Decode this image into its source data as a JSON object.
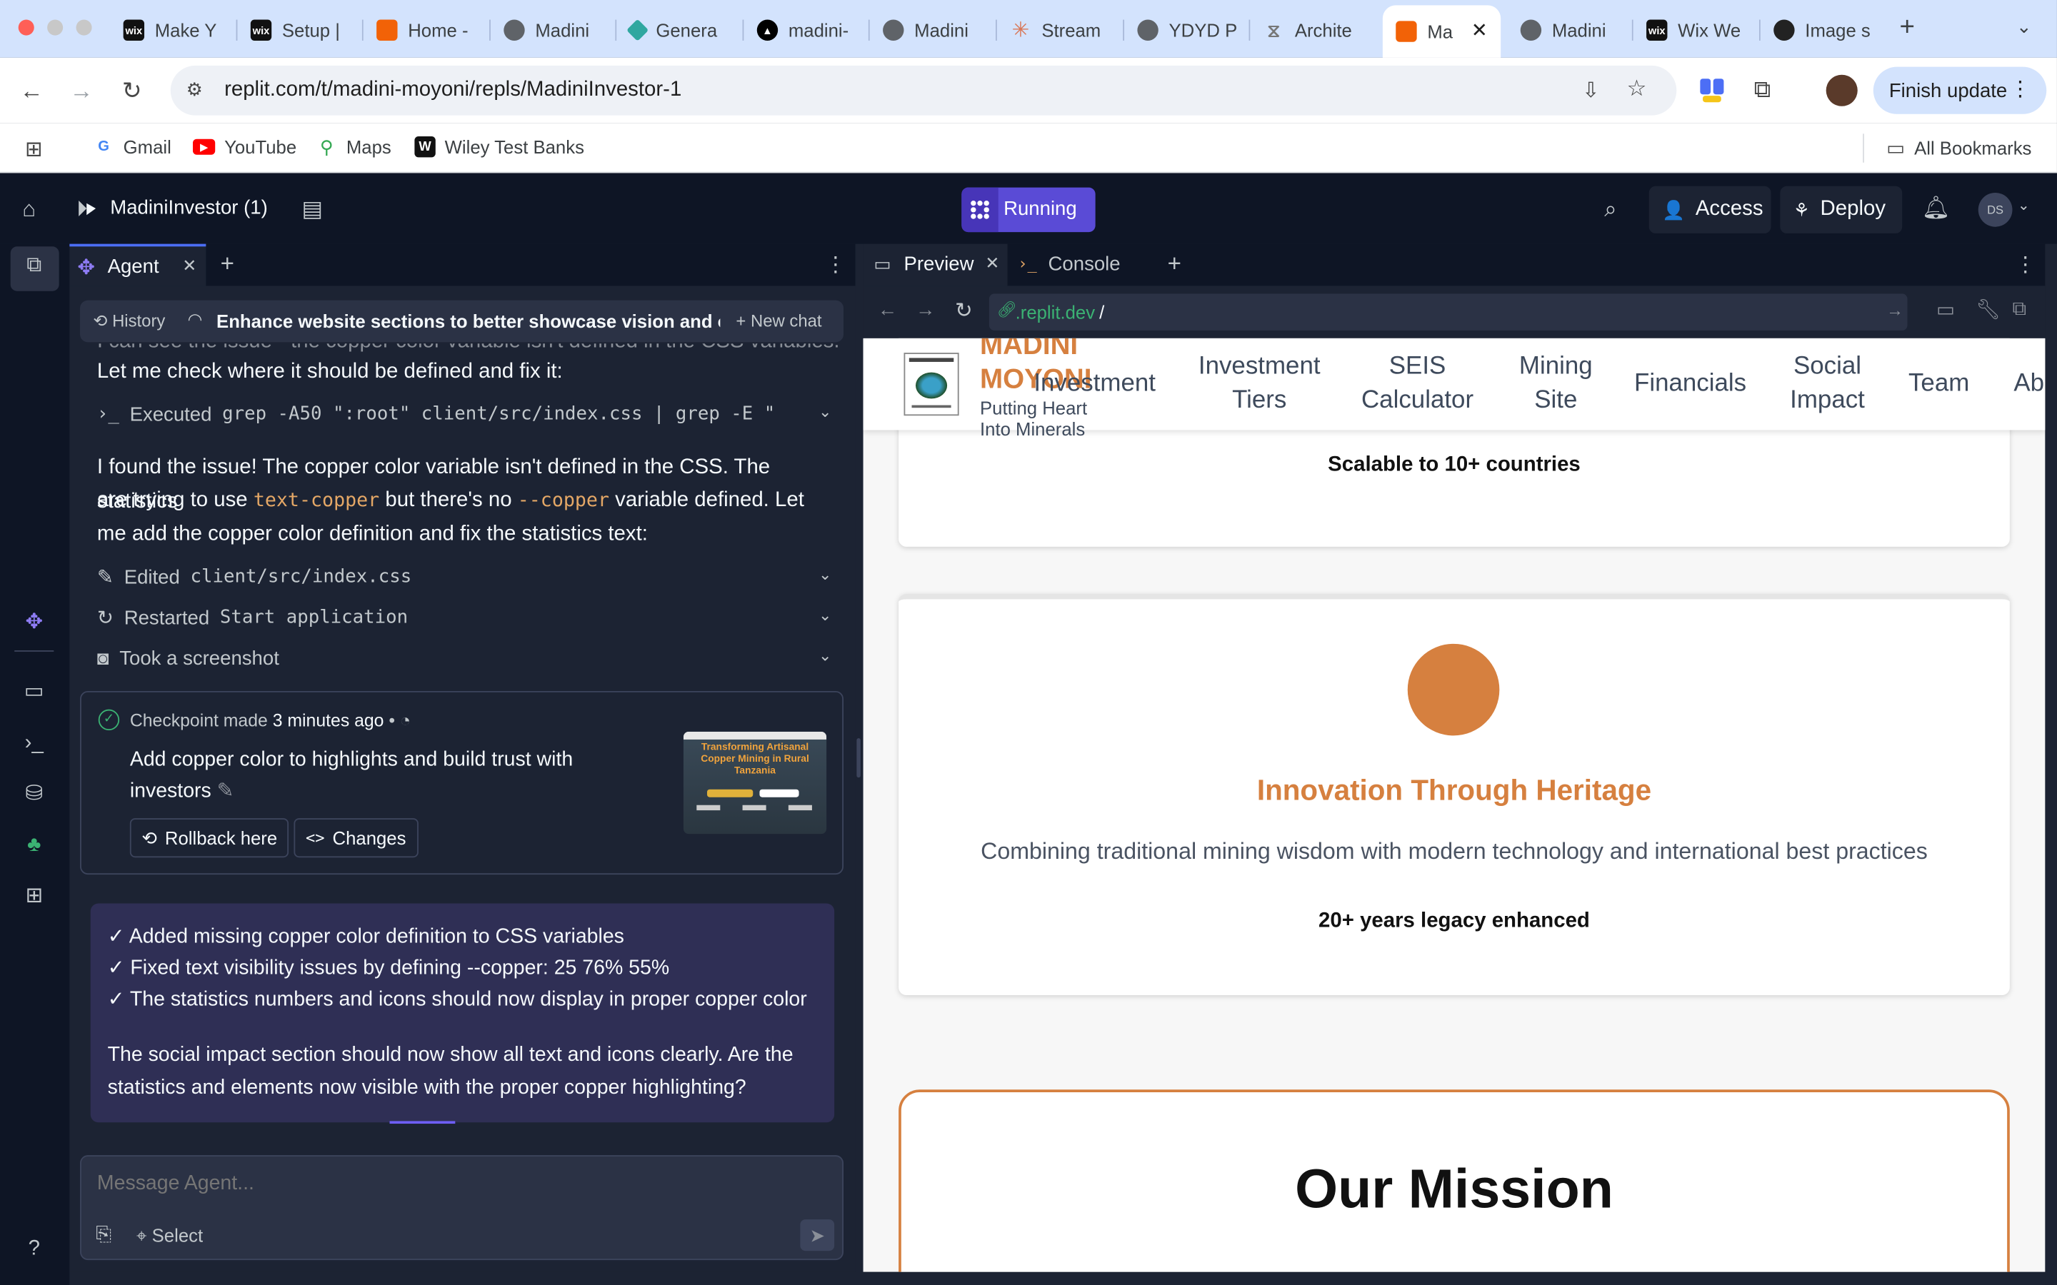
{
  "browser": {
    "tabs": [
      {
        "label": "Make Y",
        "icon": "wix"
      },
      {
        "label": "Setup |",
        "icon": "wix"
      },
      {
        "label": "Home -",
        "icon": "replit"
      },
      {
        "label": "Madini",
        "icon": "globe"
      },
      {
        "label": "Genera",
        "icon": "diamond"
      },
      {
        "label": "madini-",
        "icon": "triangle"
      },
      {
        "label": "Madini",
        "icon": "globe"
      },
      {
        "label": "Stream",
        "icon": "claude"
      },
      {
        "label": "YDYD P",
        "icon": "globe"
      },
      {
        "label": "Archite",
        "icon": "architect"
      },
      {
        "label": "Ma",
        "icon": "replit",
        "active": true
      },
      {
        "label": "Madini",
        "icon": "globe"
      },
      {
        "label": "Wix We",
        "icon": "wix"
      },
      {
        "label": "Image s",
        "icon": "openai"
      }
    ],
    "url": "replit.com/t/madini-moyoni/repls/MadiniInvestor-1",
    "finish_update": "Finish update",
    "bookmarks": [
      "Gmail",
      "YouTube",
      "Maps",
      "Wiley Test Banks"
    ],
    "all_bookmarks": "All Bookmarks"
  },
  "replit": {
    "project_name": "MadiniInvestor (1)",
    "status": "Running",
    "access": "Access",
    "deploy": "Deploy",
    "avatar": "DS"
  },
  "agent": {
    "tab_label": "Agent",
    "history": "History",
    "thread_title": "Enhance website sections to better showcase vision and oppo...",
    "new_chat": "New chat",
    "partial_line": "I can see the issue - the copper color variable isn't defined in the CSS variables.",
    "line1": "Let me check where it should be defined and fix it:",
    "executed_label": "Executed",
    "executed_cmd": "grep -A50 \":root\" client/src/index.css | grep -E \"...",
    "para_a": "I found the issue! The copper color variable isn't defined in the CSS. The statistics",
    "para_b1": "are trying to use",
    "code1": "text-copper",
    "para_b2": "but there's no",
    "code2": "--copper",
    "para_b3": "variable defined. Let",
    "para_c": "me add the copper color definition and fix the statistics text:",
    "edited_label": "Edited",
    "edited_file": "client/src/index.css",
    "restarted_label": "Restarted",
    "restarted_name": "Start application",
    "screenshot_label": "Took a screenshot",
    "checkpoint": {
      "made": "Checkpoint made",
      "time": "3 minutes ago",
      "desc_line1": "Add copper color to highlights and build trust with",
      "desc_line2": "investors",
      "rollback": "Rollback here",
      "changes": "Changes",
      "thumb_title": "Transforming Artisanal Copper Mining in Rural Tanzania"
    },
    "summary": {
      "items": [
        "✓ Added missing copper color definition to CSS variables",
        "✓ Fixed text visibility issues by defining --copper: 25 76% 55%",
        "✓ The statistics numbers and icons should now display in proper copper color"
      ],
      "question_1": "The social impact section should now show all text and icons clearly. Are the",
      "question_2": "statistics and elements now visible with the proper copper highlighting?"
    },
    "input_placeholder": "Message Agent...",
    "select": "Select"
  },
  "preview": {
    "tab_preview": "Preview",
    "tab_console": "Console",
    "url_domain": ".replit.dev",
    "url_path": "/",
    "site": {
      "logo_title_1": "MADINI",
      "logo_title_2": "MOYONI",
      "tagline_1": "Putting Heart",
      "tagline_2": "Into Minerals",
      "nav": [
        {
          "l1": "Investment",
          "l2": ""
        },
        {
          "l1": "Investment",
          "l2": "Tiers"
        },
        {
          "l1": "SEIS",
          "l2": "Calculator"
        },
        {
          "l1": "Mining",
          "l2": "Site"
        },
        {
          "l1": "Financials",
          "l2": ""
        },
        {
          "l1": "Social",
          "l2": "Impact"
        },
        {
          "l1": "Team",
          "l2": ""
        },
        {
          "l1": "Ab",
          "l2": ""
        }
      ],
      "card1_stat": "Scalable to 10+ countries",
      "card2_title": "Innovation Through Heritage",
      "card2_desc": "Combining traditional mining wisdom with modern technology and international best practices",
      "card2_stat": "20+ years legacy enhanced",
      "mission_title": "Our Mission"
    }
  },
  "colors": {
    "copper": "#d6803f",
    "replit_bg": "#1c2333",
    "replit_dark": "#0e1525",
    "running": "#5a4bd6"
  }
}
